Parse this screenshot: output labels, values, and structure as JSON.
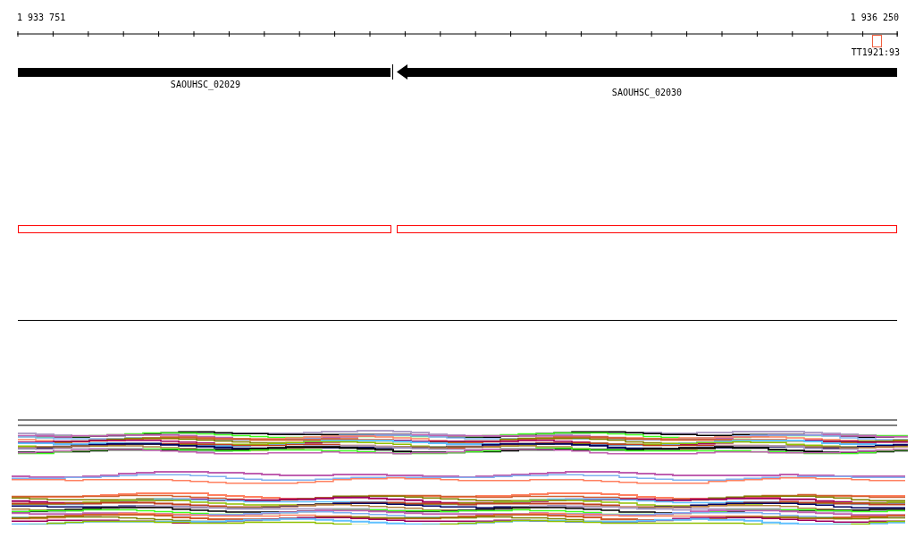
{
  "ruler": {
    "start": "1 933 751",
    "end": "1 936 250",
    "marker": {
      "label": "TT1921:93"
    }
  },
  "genes": [
    {
      "name": "SAOUHSC_02029",
      "arrowhead": false
    },
    {
      "name": "SAOUHSC_02030",
      "arrowhead": true
    }
  ]
}
